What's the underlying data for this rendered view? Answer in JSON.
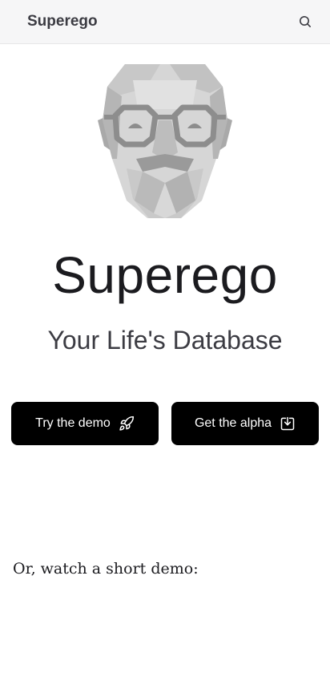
{
  "navbar": {
    "brand": "Superego",
    "search_icon": "search-icon"
  },
  "hero": {
    "logo_icon": "freud-portrait-logo",
    "title": "Superego",
    "tagline": "Your Life's Database"
  },
  "actions": {
    "demo_label": "Try the demo",
    "demo_icon": "rocket-icon",
    "alpha_label": "Get the alpha",
    "alpha_icon": "download-icon"
  },
  "video": {
    "label": "Or, watch a short demo:"
  },
  "colors": {
    "navbar_bg": "#f6f6f7",
    "button_bg": "#000000",
    "button_text": "#ffffff",
    "title_text": "#1b1b1f"
  }
}
